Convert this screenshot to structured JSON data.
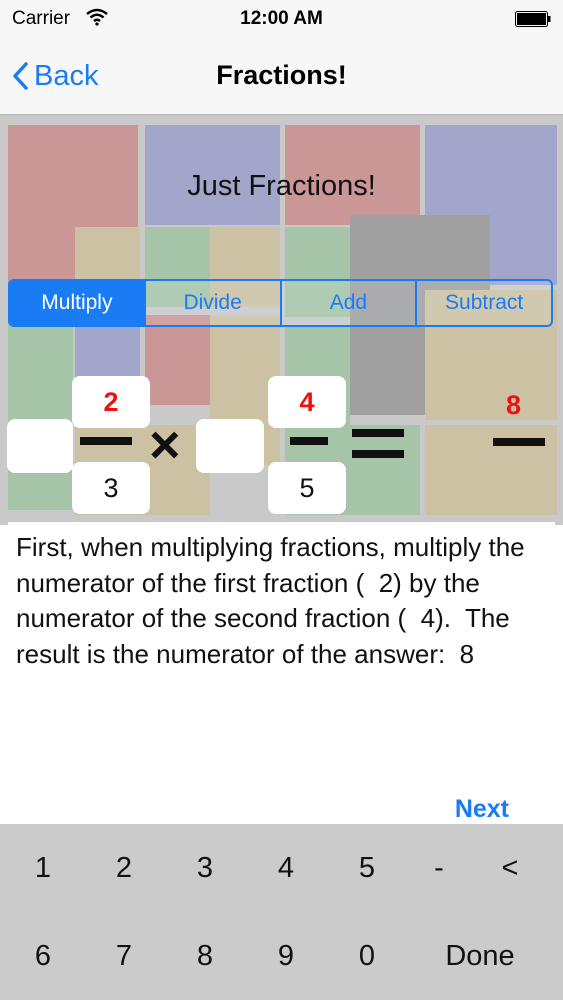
{
  "status": {
    "carrier": "Carrier",
    "time": "12:00 AM"
  },
  "nav": {
    "back_label": "Back",
    "title": "Fractions!"
  },
  "main": {
    "subtitle": "Just Fractions!",
    "segments": [
      "Multiply",
      "Divide",
      "Add",
      "Subtract"
    ],
    "selected_segment": "Multiply"
  },
  "equation": {
    "first": {
      "whole": "",
      "numerator": "2",
      "denominator": "3"
    },
    "operator": "×",
    "second": {
      "whole": "",
      "numerator": "4",
      "denominator": "5"
    },
    "equals": "=",
    "answer": {
      "numerator": "8"
    }
  },
  "explanation": {
    "text": "First, when multiplying fractions, multiply the numerator of the first fraction (  2) by the numerator of the second fraction (  4).  The result is the numerator of the answer:  8",
    "next_label": "Next"
  },
  "keypad": {
    "row1": [
      "1",
      "2",
      "3",
      "4",
      "5",
      "-",
      "<"
    ],
    "row2": [
      "6",
      "7",
      "8",
      "9",
      "0",
      "Done"
    ]
  },
  "colors": {
    "accent": "#1a7cf5",
    "numerator": "#ee1111"
  }
}
